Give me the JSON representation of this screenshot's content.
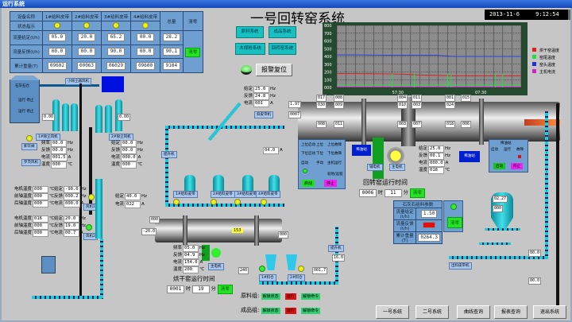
{
  "window": {
    "title": "运行系统"
  },
  "header": {
    "title": "一号回转窑系统",
    "date": "2013-11-6",
    "time": "9:12:54"
  },
  "feed_table": {
    "corner": "设备名称",
    "status_label": "状态指示",
    "total_header": "总量",
    "clear_label": "清零",
    "columns": [
      "1#给料皮带",
      "2#给料皮带",
      "3#给料皮带",
      "4#给料皮带"
    ],
    "rows": [
      {
        "label": "流量给定(t/h)",
        "values": [
          "05.0",
          "20.0",
          "65.2",
          "00.0"
        ],
        "total": "28.2"
      },
      {
        "label": "流量反馈(t/h)",
        "values": [
          "00.0",
          "00.0",
          "90.0",
          "00.0"
        ],
        "total": "90.1"
      },
      {
        "label": "累计重量(T)",
        "values": [
          "09602",
          "00063",
          "06029",
          "09600"
        ],
        "total": "9104"
      }
    ]
  },
  "nav": {
    "buttons": [
      "原料系统",
      "成品系统",
      "木煤粉系统",
      "回转窑系统"
    ],
    "alarm_reset": "报警复位"
  },
  "trend": {
    "y_ticks": [
      "800",
      "700",
      "600",
      "500",
      "400",
      "300",
      "200",
      "100",
      "000"
    ],
    "x_ticks": [
      "57:30",
      "07:30"
    ],
    "legend": [
      {
        "name": "烘干窑温度",
        "color": "#e02020"
      },
      {
        "name": "窑尾温度",
        "color": "#20e040"
      },
      {
        "name": "窑头温度",
        "color": "#2030e0"
      },
      {
        "name": "主机电流",
        "color": "#d020d0"
      }
    ],
    "series": {
      "red": [
        180,
        180,
        178,
        175,
        170,
        160,
        155,
        150,
        150,
        150,
        150,
        150
      ],
      "green": [
        30,
        30,
        30,
        30,
        30,
        30,
        30,
        30,
        30,
        30,
        30,
        30
      ],
      "blue": [
        420,
        420,
        418,
        415,
        415,
        415,
        415,
        400,
        400,
        400,
        400,
        400
      ],
      "magenta": [
        5,
        5,
        5,
        5,
        5,
        5,
        5,
        5,
        5,
        5,
        5,
        5
      ]
    }
  },
  "readouts": {
    "kiln_feed": [
      {
        "l": "给定",
        "v": "25.0",
        "u": "Hz"
      },
      {
        "l": "反馈",
        "v": "24.8",
        "u": "Hz"
      },
      {
        "l": "电流",
        "v": "001",
        "u": "A"
      }
    ],
    "kiln_vals": [
      "017",
      "008",
      "004",
      "011",
      "001",
      "015",
      "030",
      "009",
      "010",
      "003",
      "024",
      "008",
      "011",
      "003",
      "007",
      "018",
      "006"
    ],
    "kiln_in": [
      "1.97",
      "0007"
    ],
    "main_motor": [
      {
        "l": "给定",
        "v": "25.0",
        "u": "Hz"
      },
      {
        "l": "反馈",
        "v": "00.1",
        "u": "Hz"
      },
      {
        "l": "电流",
        "v": "000.0",
        "u": "A"
      },
      {
        "l": "温度",
        "v": "018",
        "u": "℃"
      }
    ],
    "fan_left": [
      {
        "l": "频率",
        "v": "00.0",
        "u": "Hz"
      },
      {
        "l": "反馈",
        "v": "00.0",
        "u": "Hz"
      },
      {
        "l": "电流",
        "v": "001.5",
        "u": "A"
      },
      {
        "l": "温度",
        "v": "000",
        "u": "℃"
      }
    ],
    "fan_right": [
      {
        "l": "给定",
        "v": "00.0",
        "u": "Hz"
      },
      {
        "l": "反馈",
        "v": "00.0",
        "u": "Hz"
      },
      {
        "l": "电流",
        "v": "000.0",
        "u": "A"
      },
      {
        "l": "温度",
        "v": "000",
        "u": "℃"
      }
    ],
    "fan1_temps": [
      {
        "l": "电机温度",
        "v": "000",
        "u": "℃"
      },
      {
        "l": "前轴温度",
        "v": "000",
        "u": "℃"
      },
      {
        "l": "后轴温度",
        "v": "000",
        "u": "℃"
      }
    ],
    "fan1_drive": [
      {
        "l": "给定",
        "v": "-90.0",
        "u": "Hz"
      },
      {
        "l": "反馈",
        "v": "000.2",
        "u": "Hz"
      },
      {
        "l": "电流",
        "v": "000.0",
        "u": "A"
      }
    ],
    "fan2_temps": [
      {
        "l": "电机温度",
        "v": "016",
        "u": "℃"
      },
      {
        "l": "前轴温度",
        "v": "000",
        "u": "℃"
      },
      {
        "l": "后轴温度",
        "v": "000",
        "u": "℃"
      }
    ],
    "fan2_drive": [
      {
        "l": "给定",
        "v": "20.0",
        "u": "Hz"
      },
      {
        "l": "反馈",
        "v": "19.0",
        "u": "Hz"
      },
      {
        "l": "电流",
        "v": "00.7",
        "u": "A"
      }
    ],
    "elevator": [
      {
        "l": "给定",
        "v": "40.0",
        "u": "Hz"
      },
      {
        "l": "电流",
        "v": "022",
        "u": "A"
      }
    ],
    "dryer": [
      {
        "l": "频率",
        "v": "05.0",
        "u": "Hz"
      },
      {
        "l": "反馈",
        "v": "04.9",
        "u": "Hz"
      },
      {
        "l": "电流",
        "v": "154.0",
        "u": "A"
      },
      {
        "l": "温度",
        "v": "200",
        "u": "℃"
      }
    ],
    "misc": {
      "temp_center": "153",
      "pa": "-20.0",
      "dryer_in": "000",
      "dryer_out": "000",
      "lift_a": "04.0",
      "elev_a": "16.0",
      "mot1": "240",
      "mot2": "001.7",
      "silo_top": "02.27",
      "silo_mid": "000",
      "belt_r1": "00.0",
      "belt_r2": "00.0",
      "p1": "0.00",
      "p2": "0.00",
      "mid": "20.0"
    }
  },
  "kiln_runtime": {
    "title": "回转窑运行时间",
    "hours": "0006",
    "h_unit": "时",
    "minutes": "11",
    "m_unit": "分",
    "reset": "清零"
  },
  "dryer_runtime": {
    "title": "烘干窑运行时间",
    "hours": "0001",
    "h_unit": "时",
    "minutes": "19",
    "m_unit": "分",
    "reset": "清零"
  },
  "feeder_table": {
    "title": "石灰石给料参数",
    "rows": [
      {
        "label": "流量给定(t/h)",
        "value": "1.50"
      },
      {
        "label": "流量反馈(t/h)",
        "value": ""
      },
      {
        "label": "累计重量(T)",
        "value": "0264.3"
      }
    ],
    "reset": "清零"
  },
  "control_panel": {
    "labels": [
      "上位启动",
      "上位",
      "上位故障",
      "下位启动",
      "下位",
      "下位故障",
      "自动",
      "手动",
      "主机运行",
      "远程"
    ],
    "mode": "就地/远程",
    "buttons": [
      "启动",
      "停止"
    ]
  },
  "lube_panel": {
    "title": "稀油站",
    "labels": [
      "启动",
      "运行",
      "故障"
    ],
    "buttons": [
      "启动",
      "停止"
    ]
  },
  "groups": [
    {
      "label": "原料组:",
      "unlock_state": "解锁状态",
      "alarm": "运行",
      "unlock_cmd": "解锁命令"
    },
    {
      "label": "成品组:",
      "unlock_state": "解锁状态",
      "alarm": "运行",
      "unlock_cmd": "解锁命令"
    }
  ],
  "tags": {
    "silo": "石灰石仓",
    "silo_run1": "运行 停止",
    "silo_run2": "运行 停止",
    "dust_top": "小除尘器风机",
    "fan_a": "风机1",
    "fan_b": "风机2",
    "fan_left": "1#除尘风机",
    "fan_right": "2#除尘风机",
    "pump": "卸灰阀",
    "blower": "罗茨风机",
    "elev1": "提升机",
    "elev2": "提升机",
    "belt1": "斜皮带机",
    "bin1": "1#给料皮带",
    "bin2": "2#给料皮带",
    "bin3": "3#给料皮带",
    "bin4": "4#给料皮带",
    "kiln_fan": "链斗机",
    "burner": "煤粉炉",
    "main_motor": "主电机",
    "aux": "辅电机",
    "dryer_motor": "主电机",
    "lower_belt": "皮带机",
    "bin_a": "1#料仓",
    "bin_b": "2#料仓",
    "lube": "稀油站",
    "unit": "A",
    "oil": "稀油站",
    "belt_r": "出料皮带机"
  },
  "bottom_nav": [
    "一号系统",
    "二号系统",
    "曲线查询",
    "报表查询",
    "退出系统"
  ]
}
